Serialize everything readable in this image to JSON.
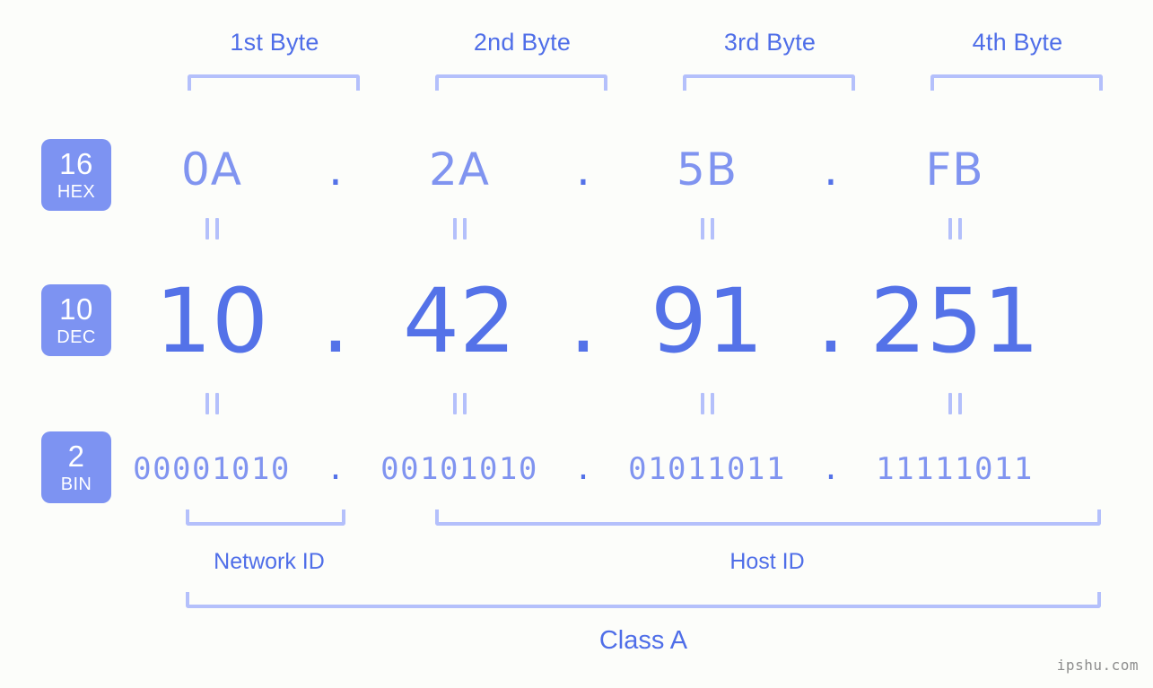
{
  "background_color": "#fcfdfa",
  "colors": {
    "accent_strong": "#5472e8",
    "accent_light": "#8094f0",
    "bracket": "#b4c0fb",
    "badge_bg": "#7d93f2",
    "label_blue": "#4f6ee8",
    "watermark": "#8d8d8d"
  },
  "byte_headers": [
    {
      "label": "1st Byte"
    },
    {
      "label": "2nd Byte"
    },
    {
      "label": "3rd Byte"
    },
    {
      "label": "4th Byte"
    }
  ],
  "rows": [
    {
      "base": "16",
      "base_name": "HEX",
      "values": [
        "0A",
        "2A",
        "5B",
        "FB"
      ],
      "separator": "."
    },
    {
      "base": "10",
      "base_name": "DEC",
      "values": [
        "10",
        "42",
        "91",
        "251"
      ],
      "separator": "."
    },
    {
      "base": "2",
      "base_name": "BIN",
      "values": [
        "00001010",
        "00101010",
        "01011011",
        "11111011"
      ],
      "separator": "."
    }
  ],
  "sections": {
    "network_id": "Network ID",
    "host_id": "Host ID",
    "class": "Class A"
  },
  "watermark": "ipshu.com"
}
